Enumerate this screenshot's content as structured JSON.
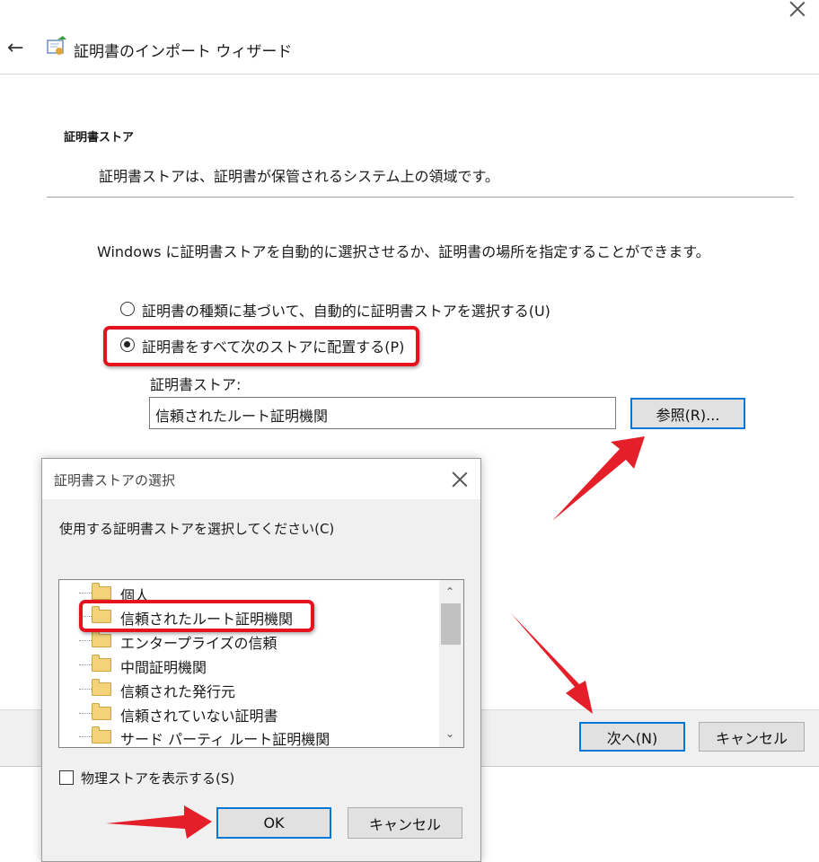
{
  "wizard": {
    "title": "証明書のインポート ウィザード",
    "section_heading": "証明書ストア",
    "section_desc": "証明書ストアは、証明書が保管されるシステム上の領域です。",
    "intro": "Windows に証明書ストアを自動的に選択させるか、証明書の場所を指定することができます。",
    "radio_auto": "証明書の種類に基づいて、自動的に証明書ストアを選択する(U)",
    "radio_manual": "証明書をすべて次のストアに配置する(P)",
    "store_label": "証明書ストア:",
    "store_value": "信頼されたルート証明機関",
    "browse_label": "参照(R)...",
    "next_label": "次へ(N)",
    "cancel_label": "キャンセル"
  },
  "dialog": {
    "title": "証明書ストアの選択",
    "prompt": "使用する証明書ストアを選択してください(C)",
    "stores": [
      "個人",
      "信頼されたルート証明機関",
      "エンタープライズの信頼",
      "中間証明機関",
      "信頼された発行元",
      "信頼されていない証明書",
      "サード パーティ ルート証明機関"
    ],
    "selected_store": "信頼されたルート証明機関",
    "show_physical_label": "物理ストアを表示する(S)",
    "show_physical_checked": false,
    "ok_label": "OK",
    "cancel_label": "キャンセル"
  },
  "colors": {
    "highlight_red": "#e4131d",
    "focus_blue": "#0078d7"
  }
}
